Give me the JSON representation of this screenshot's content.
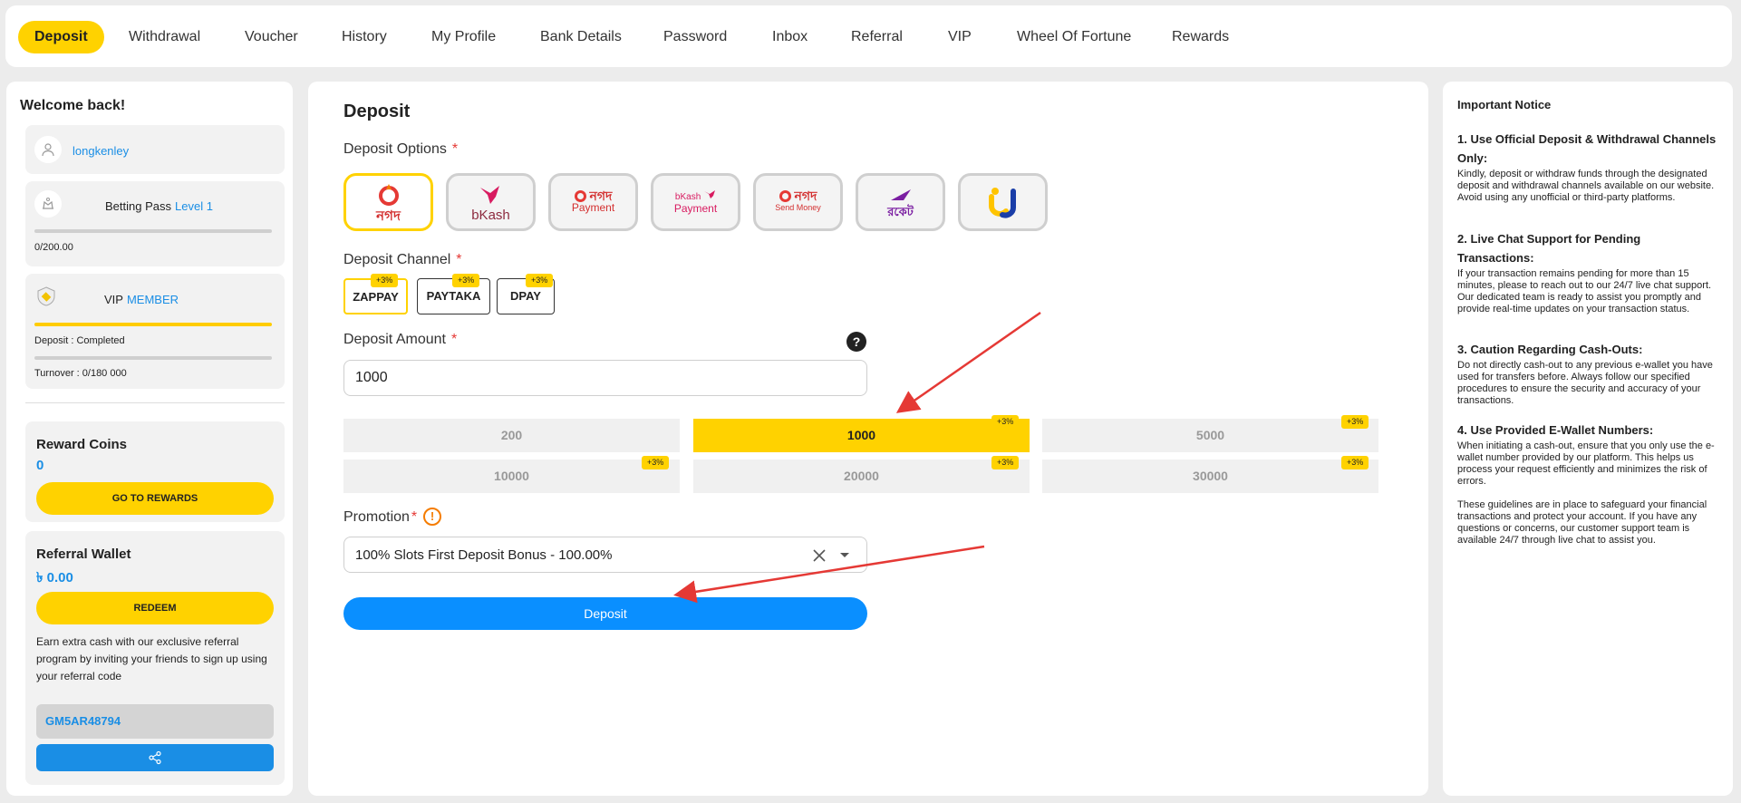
{
  "nav": {
    "tabs": [
      {
        "label": "Deposit",
        "active": true
      },
      {
        "label": "Withdrawal"
      },
      {
        "label": "Voucher"
      },
      {
        "label": "History"
      },
      {
        "label": "My Profile"
      },
      {
        "label": "Bank Details"
      },
      {
        "label": "Password"
      },
      {
        "label": "Inbox"
      },
      {
        "label": "Referral"
      },
      {
        "label": "VIP"
      },
      {
        "label": "Wheel Of Fortune"
      },
      {
        "label": "Rewards"
      }
    ]
  },
  "sidebar": {
    "welcome": "Welcome back!",
    "username": "longkenley",
    "betting_pass": {
      "label": "Betting Pass",
      "level": "Level 1",
      "progress_text": "0/200.00",
      "progress": 0
    },
    "vip": {
      "label": "VIP",
      "tier": "MEMBER",
      "deposit_text": "Deposit : Completed",
      "deposit_progress": 1.0,
      "turnover_text": "Turnover : 0/180 000",
      "turnover_progress": 0
    },
    "reward_coins": {
      "title": "Reward Coins",
      "value": "0",
      "button": "GO TO REWARDS"
    },
    "referral": {
      "title": "Referral Wallet",
      "value": "৳ 0.00",
      "button": "REDEEM",
      "description": "Earn extra cash with our exclusive referral program by inviting your friends to sign up using your referral code",
      "code": "GM5AR48794"
    }
  },
  "main": {
    "title": "Deposit",
    "options_label": "Deposit Options",
    "options": [
      {
        "name": "nagad",
        "line1": "নগদ",
        "selected": true
      },
      {
        "name": "bkash",
        "line1": "bKash"
      },
      {
        "name": "nagad-payment",
        "line1": "নগদ",
        "line2": "Payment"
      },
      {
        "name": "bkash-payment",
        "line1": "bKash",
        "line2": "Payment"
      },
      {
        "name": "nagad-send-money",
        "line1": "নগদ",
        "line2": "Send Money"
      },
      {
        "name": "rocket",
        "line1": "রকেট"
      },
      {
        "name": "upay",
        "line1": ""
      }
    ],
    "channel_label": "Deposit Channel",
    "channels": [
      {
        "label": "ZAPPAY",
        "badge": "+3%",
        "selected": true
      },
      {
        "label": "PAYTAKA",
        "badge": "+3%"
      },
      {
        "label": "DPAY",
        "badge": "+3%"
      }
    ],
    "amount_label": "Deposit Amount",
    "help_glyph": "?",
    "amount_value": "1000",
    "amounts": [
      {
        "value": "200"
      },
      {
        "value": "1000",
        "badge": "+3%",
        "selected": true
      },
      {
        "value": "5000",
        "badge": "+3%"
      },
      {
        "value": "10000",
        "badge": "+3%"
      },
      {
        "value": "20000",
        "badge": "+3%"
      },
      {
        "value": "30000",
        "badge": "+3%"
      }
    ],
    "promotion_label": "Promotion",
    "info_glyph": "!",
    "promotion_value": "100% Slots First Deposit Bonus - 100.00%",
    "deposit_button": "Deposit",
    "required_mark": "*"
  },
  "notice": {
    "title": "Important Notice",
    "items": [
      {
        "head": "1. Use Official Deposit & Withdrawal Channels Only:",
        "body": "Kindly, deposit or withdraw funds through the designated deposit and withdrawal channels available on our website. Avoid using any unofficial or third-party platforms."
      },
      {
        "head": "2. Live Chat Support for Pending Transactions:",
        "body": "If your transaction remains pending for more than 15 minutes, please to reach out to our 24/7 live chat support. Our dedicated team is ready to assist you promptly and provide real-time updates on your transaction status."
      },
      {
        "head": "3. Caution Regarding Cash-Outs:",
        "body": "Do not directly cash-out to any previous e-wallet you have used for transfers before. Always follow our specified procedures to ensure the security and accuracy of your transactions."
      },
      {
        "head": "4. Use Provided E-Wallet Numbers:",
        "body": "When initiating a cash-out, ensure that you only use the e-wallet number provided by our platform. This helps us process your request efficiently and minimizes the risk of errors."
      }
    ],
    "footer": "These guidelines are in place to safeguard your financial transactions and protect your account. If you have any questions or concerns, our customer support team is available 24/7 through live chat to assist you."
  },
  "colors": {
    "accent": "#ffd200",
    "primary": "#0a8fff",
    "link": "#1a8ee5",
    "annotation": "#e53935"
  }
}
